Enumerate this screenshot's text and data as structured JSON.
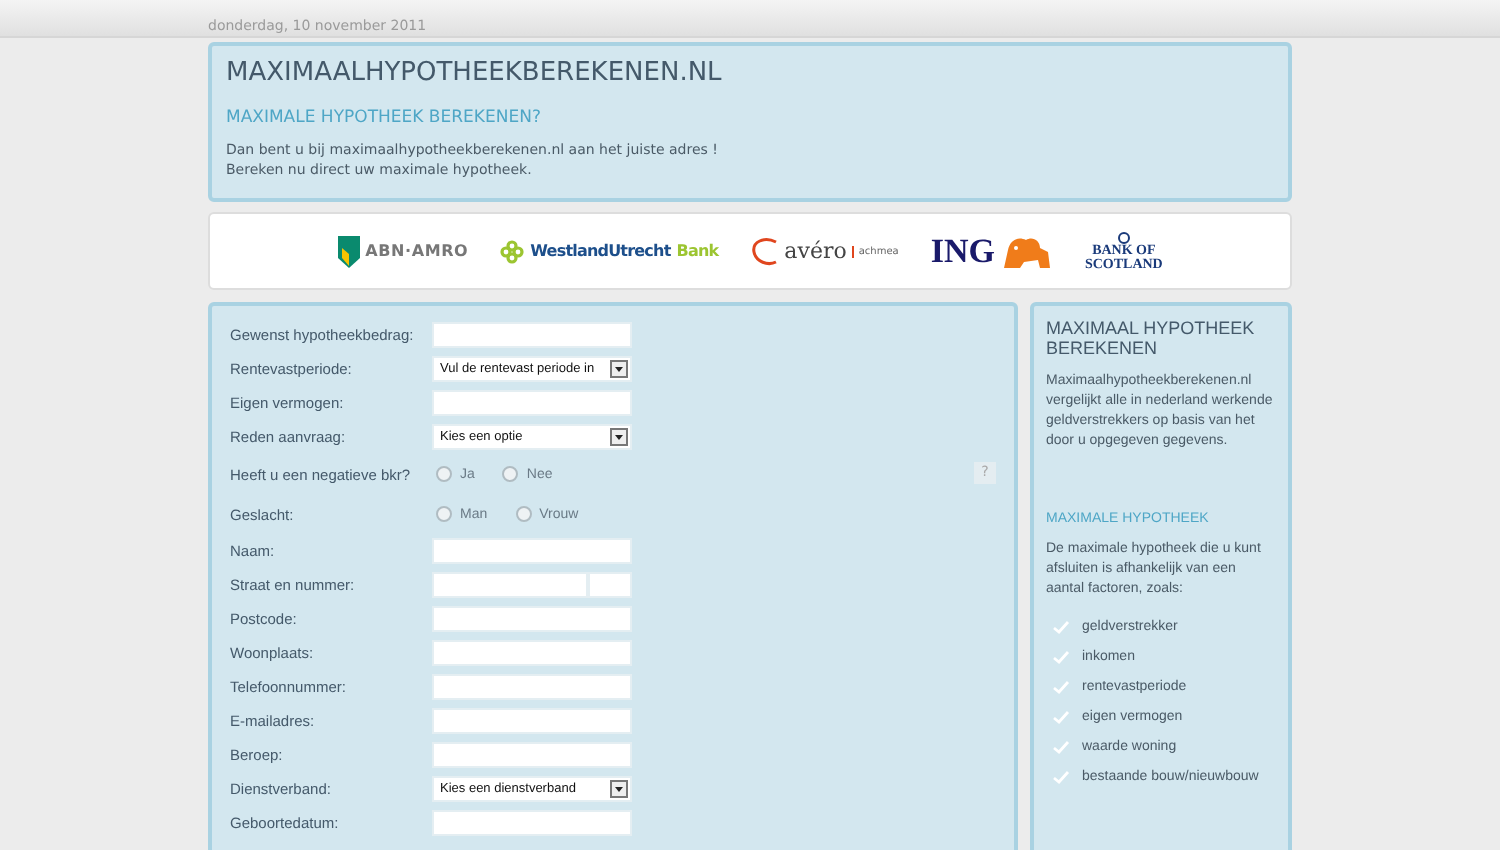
{
  "date": "donderdag, 10 november 2011",
  "header": {
    "title": "MAXIMAALHYPOTHEEKBEREKENEN.NL",
    "subtitle": "MAXIMALE HYPOTHEEK BEREKENEN?",
    "lines": [
      "Dan bent u bij maximaalhypotheekberekenen.nl aan het juiste adres !",
      "Bereken nu direct uw maximale hypotheek."
    ]
  },
  "logos": [
    {
      "kind": "abn",
      "text": "ABN·AMRO"
    },
    {
      "kind": "westland",
      "text": "WestlandUtrecht",
      "text2": "Bank"
    },
    {
      "kind": "avero",
      "text": "avéro",
      "text2": "achmea"
    },
    {
      "kind": "ing",
      "text": "ING"
    },
    {
      "kind": "bos",
      "text": "BANK OF",
      "text2": "SCOTLAND"
    }
  ],
  "form": [
    {
      "kind": "text",
      "label": "Gewenst hypotheekbedrag:"
    },
    {
      "kind": "select",
      "label": "Rentevastperiode:",
      "value": "Vul de rentevast periode in"
    },
    {
      "kind": "text",
      "label": "Eigen vermogen:"
    },
    {
      "kind": "select",
      "label": "Reden aanvraag:",
      "value": "Kies een optie"
    },
    {
      "kind": "radio",
      "label": "Heeft u een negatieve bkr?",
      "options": [
        {
          "label": "Ja",
          "selected": false
        },
        {
          "label": "Nee",
          "selected": false
        }
      ],
      "help": "?"
    },
    {
      "kind": "radio",
      "label": "Geslacht:",
      "options": [
        {
          "label": "Man",
          "selected": false
        },
        {
          "label": "Vrouw",
          "selected": false
        }
      ]
    },
    {
      "kind": "text",
      "label": "Naam:"
    },
    {
      "kind": "split",
      "label": "Straat en nummer:"
    },
    {
      "kind": "text",
      "label": "Postcode:"
    },
    {
      "kind": "text",
      "label": "Woonplaats:"
    },
    {
      "kind": "text",
      "label": "Telefoonnummer:"
    },
    {
      "kind": "text",
      "label": "E-mailadres:"
    },
    {
      "kind": "text",
      "label": "Beroep:"
    },
    {
      "kind": "select",
      "label": "Dienstverband:",
      "value": "Kies een dienstverband"
    },
    {
      "kind": "text",
      "label": "Geboortedatum:"
    }
  ],
  "sidebar": {
    "title": "MAXIMAAL HYPOTHEEK BEREKENEN",
    "intro": "Maximaalhypotheekberekenen.nl vergelijkt alle in nederland werkende geldverstrekkers op basis van het door u opgegeven gegevens.",
    "subtitle": "MAXIMALE HYPOTHEEK",
    "text": "De maximale hypotheek die u kunt afsluiten is afhankelijk van een aantal factoren, zoals:",
    "factors": [
      "geldverstrekker",
      "inkomen",
      "rentevastperiode",
      "eigen vermogen",
      "waarde woning",
      "bestaande bouw/nieuwbouw"
    ]
  }
}
